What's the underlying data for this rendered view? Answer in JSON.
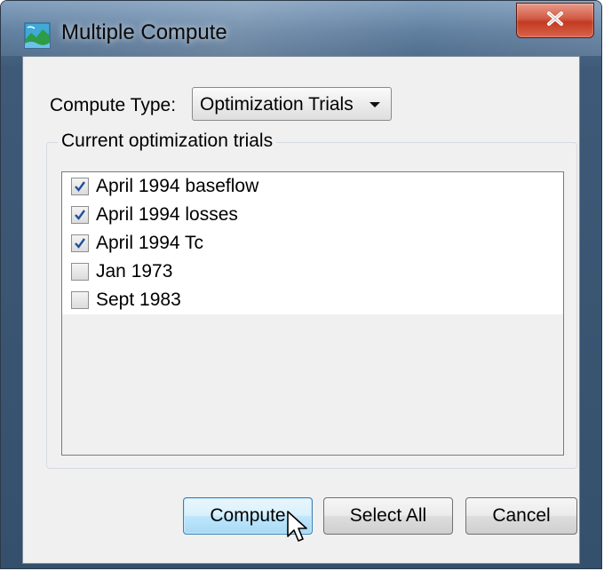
{
  "window": {
    "title": "Multiple Compute",
    "close_label": "X"
  },
  "compute_type": {
    "label": "Compute Type:",
    "selected": "Optimization Trials"
  },
  "trials": {
    "group_title": "Current optimization trials",
    "items": [
      {
        "label": "April 1994 baseflow",
        "checked": true
      },
      {
        "label": "April 1994 losses",
        "checked": true
      },
      {
        "label": "April 1994 Tc",
        "checked": true
      },
      {
        "label": "Jan 1973",
        "checked": false
      },
      {
        "label": "Sept 1983",
        "checked": false
      }
    ]
  },
  "buttons": {
    "compute": "Compute",
    "select_all": "Select All",
    "cancel": "Cancel"
  },
  "icons": {
    "app": "watershed-icon",
    "close": "close-icon",
    "check": "checkmark-icon",
    "cursor": "mouse-pointer-icon"
  },
  "colors": {
    "titlebar": "#5a7a9c",
    "close_button": "#c23a22",
    "dialog_bg": "#f0f0f0",
    "check": "#1f4f9e",
    "primary_button_border": "#3c7fb1"
  }
}
